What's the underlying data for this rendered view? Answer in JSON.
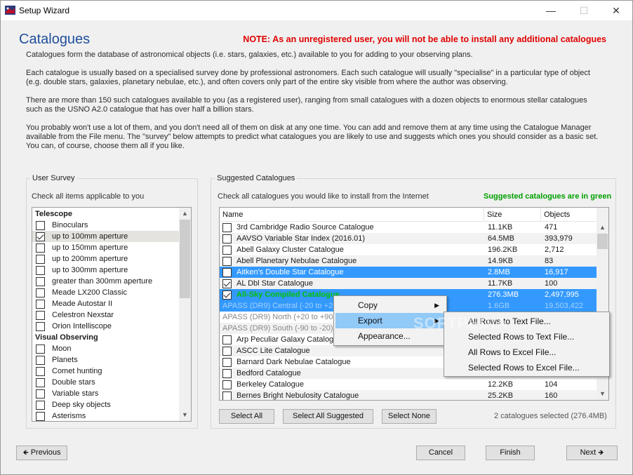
{
  "window": {
    "title": "Setup Wizard",
    "minimize": "—",
    "maximize": "☐",
    "close": "✕"
  },
  "page": {
    "heading": "Catalogues",
    "note": "NOTE: As an unregistered user, you will not be able to install any additional catalogues",
    "paragraphs": [
      "Catalogues form the database of astronomical objects (i.e. stars, galaxies, etc.) available to you for adding to your observing plans.",
      "Each catalogue is usually based on a specialised survey done by professional astronomers. Each such catalogue will usually \"specialise\" in a particular type of object (e.g. double stars, galaxies, planetary nebulae, etc.), and often covers only part of the entire sky visible from where the author was observing.",
      "There are more than 150 such catalogues available to you (as a registered user), ranging from small catalogues with a dozen objects to enormous stellar catalogues such as the USNO A2.0 catalogue that has over half a billion stars.",
      "You probably won't use a lot of them, and you don't need all of them on disk at any one time. You can add and remove them at any time using the Catalogue Manager available from the File menu. The \"survey\" below attempts to predict what catalogues you are likely to use and suggests which ones you should consider as a basic set. You can, of course, choose them all if you like."
    ]
  },
  "survey": {
    "title": "User Survey",
    "hint": "Check all items applicable to you",
    "items": [
      {
        "label": "Telescope",
        "header": true
      },
      {
        "label": "Binoculars",
        "checked": false
      },
      {
        "label": "up to 100mm aperture",
        "checked": true,
        "selected": true
      },
      {
        "label": "up to 150mm aperture",
        "checked": false
      },
      {
        "label": "up to 200mm aperture",
        "checked": false
      },
      {
        "label": "up to 300mm aperture",
        "checked": false
      },
      {
        "label": "greater than 300mm aperture",
        "checked": false
      },
      {
        "label": "Meade LX200 Classic",
        "checked": false
      },
      {
        "label": "Meade Autostar II",
        "checked": false
      },
      {
        "label": "Celestron Nexstar",
        "checked": false
      },
      {
        "label": "Orion Intelliscope",
        "checked": false
      },
      {
        "label": "Visual Observing",
        "header": true
      },
      {
        "label": "Moon",
        "checked": false
      },
      {
        "label": "Planets",
        "checked": false
      },
      {
        "label": "Comet hunting",
        "checked": false
      },
      {
        "label": "Double stars",
        "checked": false
      },
      {
        "label": "Variable stars",
        "checked": false
      },
      {
        "label": "Deep sky objects",
        "checked": false
      },
      {
        "label": "Asterisms",
        "checked": false
      }
    ]
  },
  "suggested": {
    "title": "Suggested Catalogues",
    "hint": "Check all catalogues you would like to install from the Internet",
    "green_note": "Suggested catalogues are in green",
    "columns": [
      "Name",
      "Size",
      "Objects"
    ],
    "rows": [
      {
        "name": "3rd Cambridge Radio Source Catalogue",
        "size": "11.1KB",
        "objects": "471",
        "checked": false
      },
      {
        "name": "AAVSO Variable Star Index (2016.01)",
        "size": "64.5MB",
        "objects": "393,979",
        "checked": false
      },
      {
        "name": "Abell Galaxy Cluster Catalogue",
        "size": "196.2KB",
        "objects": "2,712",
        "checked": false
      },
      {
        "name": "Abell Planetary Nebulae Catalogue",
        "size": "14.9KB",
        "objects": "83",
        "checked": false
      },
      {
        "name": "Aitken's Double Star Catalogue",
        "size": "2.8MB",
        "objects": "16,917",
        "checked": false,
        "selected": true
      },
      {
        "name": "AL Dbl Star Catalogue",
        "size": "11.7KB",
        "objects": "100",
        "checked": true
      },
      {
        "name": "All-Sky Compiled Catalogue",
        "size": "276.3MB",
        "objects": "2,497,995",
        "checked": true,
        "selected": true,
        "green": true
      },
      {
        "name": "APASS (DR9) Central (-20 to +20)",
        "size": "1.6GB",
        "objects": "19,503,422",
        "selected": true,
        "nocheck": true,
        "dim": true
      },
      {
        "name": "APASS (DR9) North (+20 to +90)",
        "size": "",
        "objects": "",
        "nocheck": true,
        "dim": true
      },
      {
        "name": "APASS (DR9) South (-90 to -20)",
        "size": "",
        "objects": "",
        "nocheck": true,
        "dim": true
      },
      {
        "name": "Arp Peculiar Galaxy Catalogue",
        "size": "",
        "objects": "",
        "checked": false
      },
      {
        "name": "ASCC Lite Catalogue",
        "size": "",
        "objects": "",
        "checked": false
      },
      {
        "name": "Barnard Dark Nebulae Catalogue",
        "size": "",
        "objects": "",
        "checked": false
      },
      {
        "name": "Bedford Catalogue",
        "size": "",
        "objects": "",
        "checked": false
      },
      {
        "name": "Berkeley Catalogue",
        "size": "12.2KB",
        "objects": "104",
        "checked": false
      },
      {
        "name": "Bernes Bright Nebulosity Catalogue",
        "size": "25.2KB",
        "objects": "160",
        "checked": false
      }
    ],
    "buttons": {
      "select_all": "Select All",
      "select_suggested": "Select All Suggested",
      "select_none": "Select None"
    },
    "status": "2 catalogues selected (276.4MB)"
  },
  "context_menu": {
    "items": [
      {
        "label": "Copy",
        "submenu": true
      },
      {
        "label": "Export",
        "submenu": true,
        "highlight": true
      },
      {
        "label": "Appearance..."
      }
    ],
    "export_submenu": [
      "All Rows to Text File...",
      "Selected Rows to Text File...",
      "All Rows to Excel File...",
      "Selected Rows to Excel File..."
    ]
  },
  "nav": {
    "previous": "Previous",
    "cancel": "Cancel",
    "finish": "Finish",
    "next": "Next"
  },
  "watermark": "SOFTPEDIA",
  "colors": {
    "selection": "#3399ff",
    "green": "#00a000",
    "heading": "#1f4e9c",
    "note": "#e00000"
  }
}
